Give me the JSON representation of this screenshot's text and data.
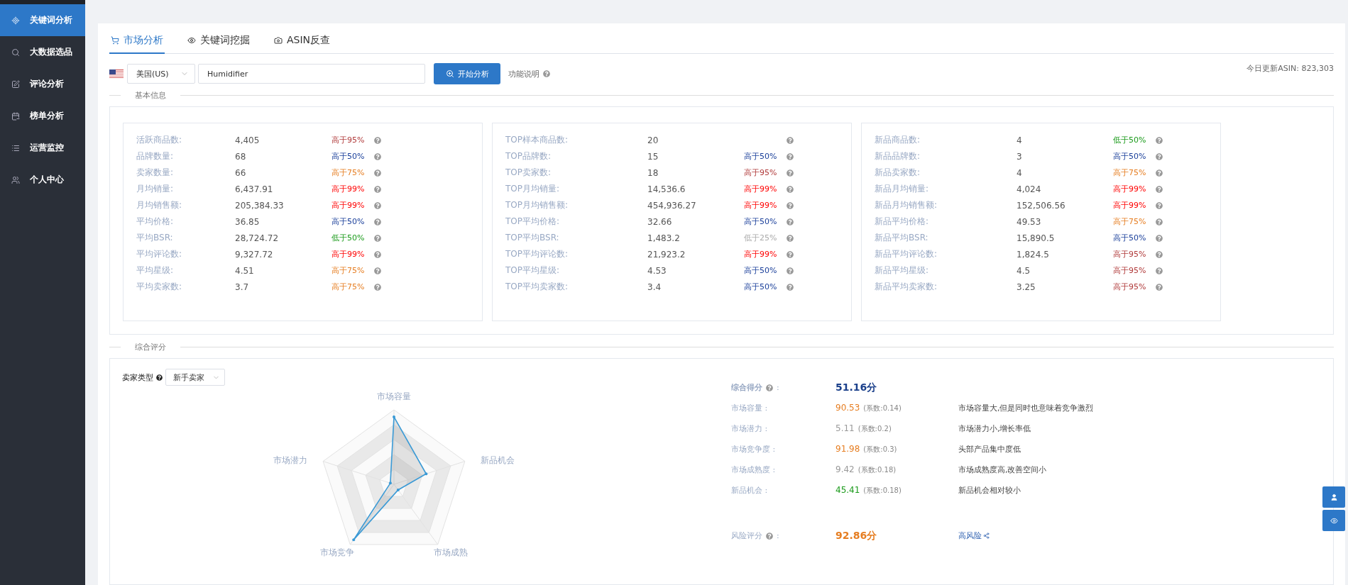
{
  "sidebar": {
    "items": [
      {
        "label": "关键词分析",
        "selected": true
      },
      {
        "label": "大数据选品",
        "selected": false
      },
      {
        "label": "评论分析",
        "selected": false
      },
      {
        "label": "榜单分析",
        "selected": false
      },
      {
        "label": "运营监控",
        "selected": false
      },
      {
        "label": "个人中心",
        "selected": false
      }
    ]
  },
  "tabs": [
    {
      "label": "市场分析",
      "selected": true
    },
    {
      "label": "关键词挖掘",
      "selected": false
    },
    {
      "label": "ASIN反查",
      "selected": false
    }
  ],
  "search": {
    "country": "美国(US)",
    "keyword": "Humidifier",
    "button": "开始分析",
    "help_link": "功能说明",
    "update_info": "今日更新ASIN: 823,303"
  },
  "basic_info": {
    "title": "基本信息",
    "groups": [
      {
        "rows": [
          {
            "label": "活跃商品数:",
            "value": "4,405",
            "tag": {
              "text": "高于95%",
              "color": "#b03a3a"
            }
          },
          {
            "label": "品牌数量:",
            "value": "68",
            "tag": {
              "text": "高于50%",
              "color": "#1a3f9a"
            }
          },
          {
            "label": "卖家数量:",
            "value": "66",
            "tag": {
              "text": "高于75%",
              "color": "#e67e22"
            }
          },
          {
            "label": "月均销量:",
            "value": "6,437.91",
            "tag": {
              "text": "高于99%",
              "color": "#ff0000"
            }
          },
          {
            "label": "月均销售额:",
            "value": "205,384.33",
            "tag": {
              "text": "高于99%",
              "color": "#ff0000"
            }
          },
          {
            "label": "平均价格:",
            "value": "36.85",
            "tag": {
              "text": "高于50%",
              "color": "#1a3f9a"
            }
          },
          {
            "label": "平均BSR:",
            "value": "28,724.72",
            "tag": {
              "text": "低于50%",
              "color": "#1a9a1a"
            }
          },
          {
            "label": "平均评论数:",
            "value": "9,327.72",
            "tag": {
              "text": "高于99%",
              "color": "#ff0000"
            }
          },
          {
            "label": "平均星级:",
            "value": "4.51",
            "tag": {
              "text": "高于75%",
              "color": "#e67e22"
            }
          },
          {
            "label": "平均卖家数:",
            "value": "3.7",
            "tag": {
              "text": "高于75%",
              "color": "#e67e22"
            }
          }
        ]
      },
      {
        "rows": [
          {
            "label": "TOP样本商品数:",
            "value": "20"
          },
          {
            "label": "TOP品牌数:",
            "value": "15",
            "tag": {
              "text": "高于50%",
              "color": "#1a3f9a"
            }
          },
          {
            "label": "TOP卖家数:",
            "value": "18",
            "tag": {
              "text": "高于95%",
              "color": "#b03a3a"
            }
          },
          {
            "label": "TOP月均销量:",
            "value": "14,536.6",
            "tag": {
              "text": "高于99%",
              "color": "#ff0000"
            }
          },
          {
            "label": "TOP月均销售额:",
            "value": "454,936.27",
            "tag": {
              "text": "高于99%",
              "color": "#ff0000"
            }
          },
          {
            "label": "TOP平均价格:",
            "value": "32.66",
            "tag": {
              "text": "高于50%",
              "color": "#1a3f9a"
            }
          },
          {
            "label": "TOP平均BSR:",
            "value": "1,483.2",
            "tag": {
              "text": "低于25%",
              "color": "#aaaaaa"
            }
          },
          {
            "label": "TOP平均评论数:",
            "value": "21,923.2",
            "tag": {
              "text": "高于99%",
              "color": "#ff0000"
            }
          },
          {
            "label": "TOP平均星级:",
            "value": "4.53",
            "tag": {
              "text": "高于50%",
              "color": "#1a3f9a"
            }
          },
          {
            "label": "TOP平均卖家数:",
            "value": "3.4",
            "tag": {
              "text": "高于50%",
              "color": "#1a3f9a"
            }
          }
        ]
      },
      {
        "rows": [
          {
            "label": "新品商品数:",
            "value": "4",
            "tag": {
              "text": "低于50%",
              "color": "#1a9a1a"
            }
          },
          {
            "label": "新品品牌数:",
            "value": "3",
            "tag": {
              "text": "高于50%",
              "color": "#1a3f9a"
            }
          },
          {
            "label": "新品卖家数:",
            "value": "4",
            "tag": {
              "text": "高于75%",
              "color": "#e67e22"
            }
          },
          {
            "label": "新品月均销量:",
            "value": "4,024",
            "tag": {
              "text": "高于99%",
              "color": "#ff0000"
            }
          },
          {
            "label": "新品月均销售额:",
            "value": "152,506.56",
            "tag": {
              "text": "高于99%",
              "color": "#ff0000"
            }
          },
          {
            "label": "新品平均价格:",
            "value": "49.53",
            "tag": {
              "text": "高于75%",
              "color": "#e67e22"
            }
          },
          {
            "label": "新品平均BSR:",
            "value": "15,890.5",
            "tag": {
              "text": "高于50%",
              "color": "#1a3f9a"
            }
          },
          {
            "label": "新品平均评论数:",
            "value": "1,824.5",
            "tag": {
              "text": "高于95%",
              "color": "#b03a3a"
            }
          },
          {
            "label": "新品平均星级:",
            "value": "4.5",
            "tag": {
              "text": "高于95%",
              "color": "#b03a3a"
            }
          },
          {
            "label": "新品平均卖家数:",
            "value": "3.25",
            "tag": {
              "text": "高于95%",
              "color": "#b03a3a"
            }
          }
        ]
      }
    ]
  },
  "score_section": {
    "title": "综合评分",
    "seller_type": {
      "label": "卖家类型",
      "value": "新手卖家"
    },
    "radar_axes": [
      "市场容量",
      "新品机会",
      "市场成熟",
      "市场竞争",
      "市场潜力"
    ],
    "total": {
      "label": "综合得分",
      "colon": ":",
      "value": "51.16分"
    },
    "scores": [
      {
        "label": "市场容量 :",
        "value": "90.53",
        "color": "#e67e22",
        "coef": "(系数:0.14)",
        "comment": "市场容量大,但是同时也意味着竞争激烈"
      },
      {
        "label": "市场潜力 :",
        "value": "5.11",
        "color": "#999999",
        "coef": "(系数:0.2)",
        "comment": "市场潜力小,增长率低"
      },
      {
        "label": "市场竞争度 :",
        "value": "91.98",
        "color": "#e67e22",
        "coef": "(系数:0.3)",
        "comment": "头部产品集中度低"
      },
      {
        "label": "市场成熟度 :",
        "value": "9.42",
        "color": "#999999",
        "coef": "(系数:0.18)",
        "comment": "市场成熟度高,改善空间小"
      },
      {
        "label": "新品机会 :",
        "value": "45.41",
        "color": "#1a9a1a",
        "coef": "(系数:0.18)",
        "comment": "新品机会相对较小"
      }
    ],
    "risk": {
      "label": "风险评分",
      "colon": ":",
      "value": "92.86分",
      "risk_text": "高风险"
    }
  }
}
